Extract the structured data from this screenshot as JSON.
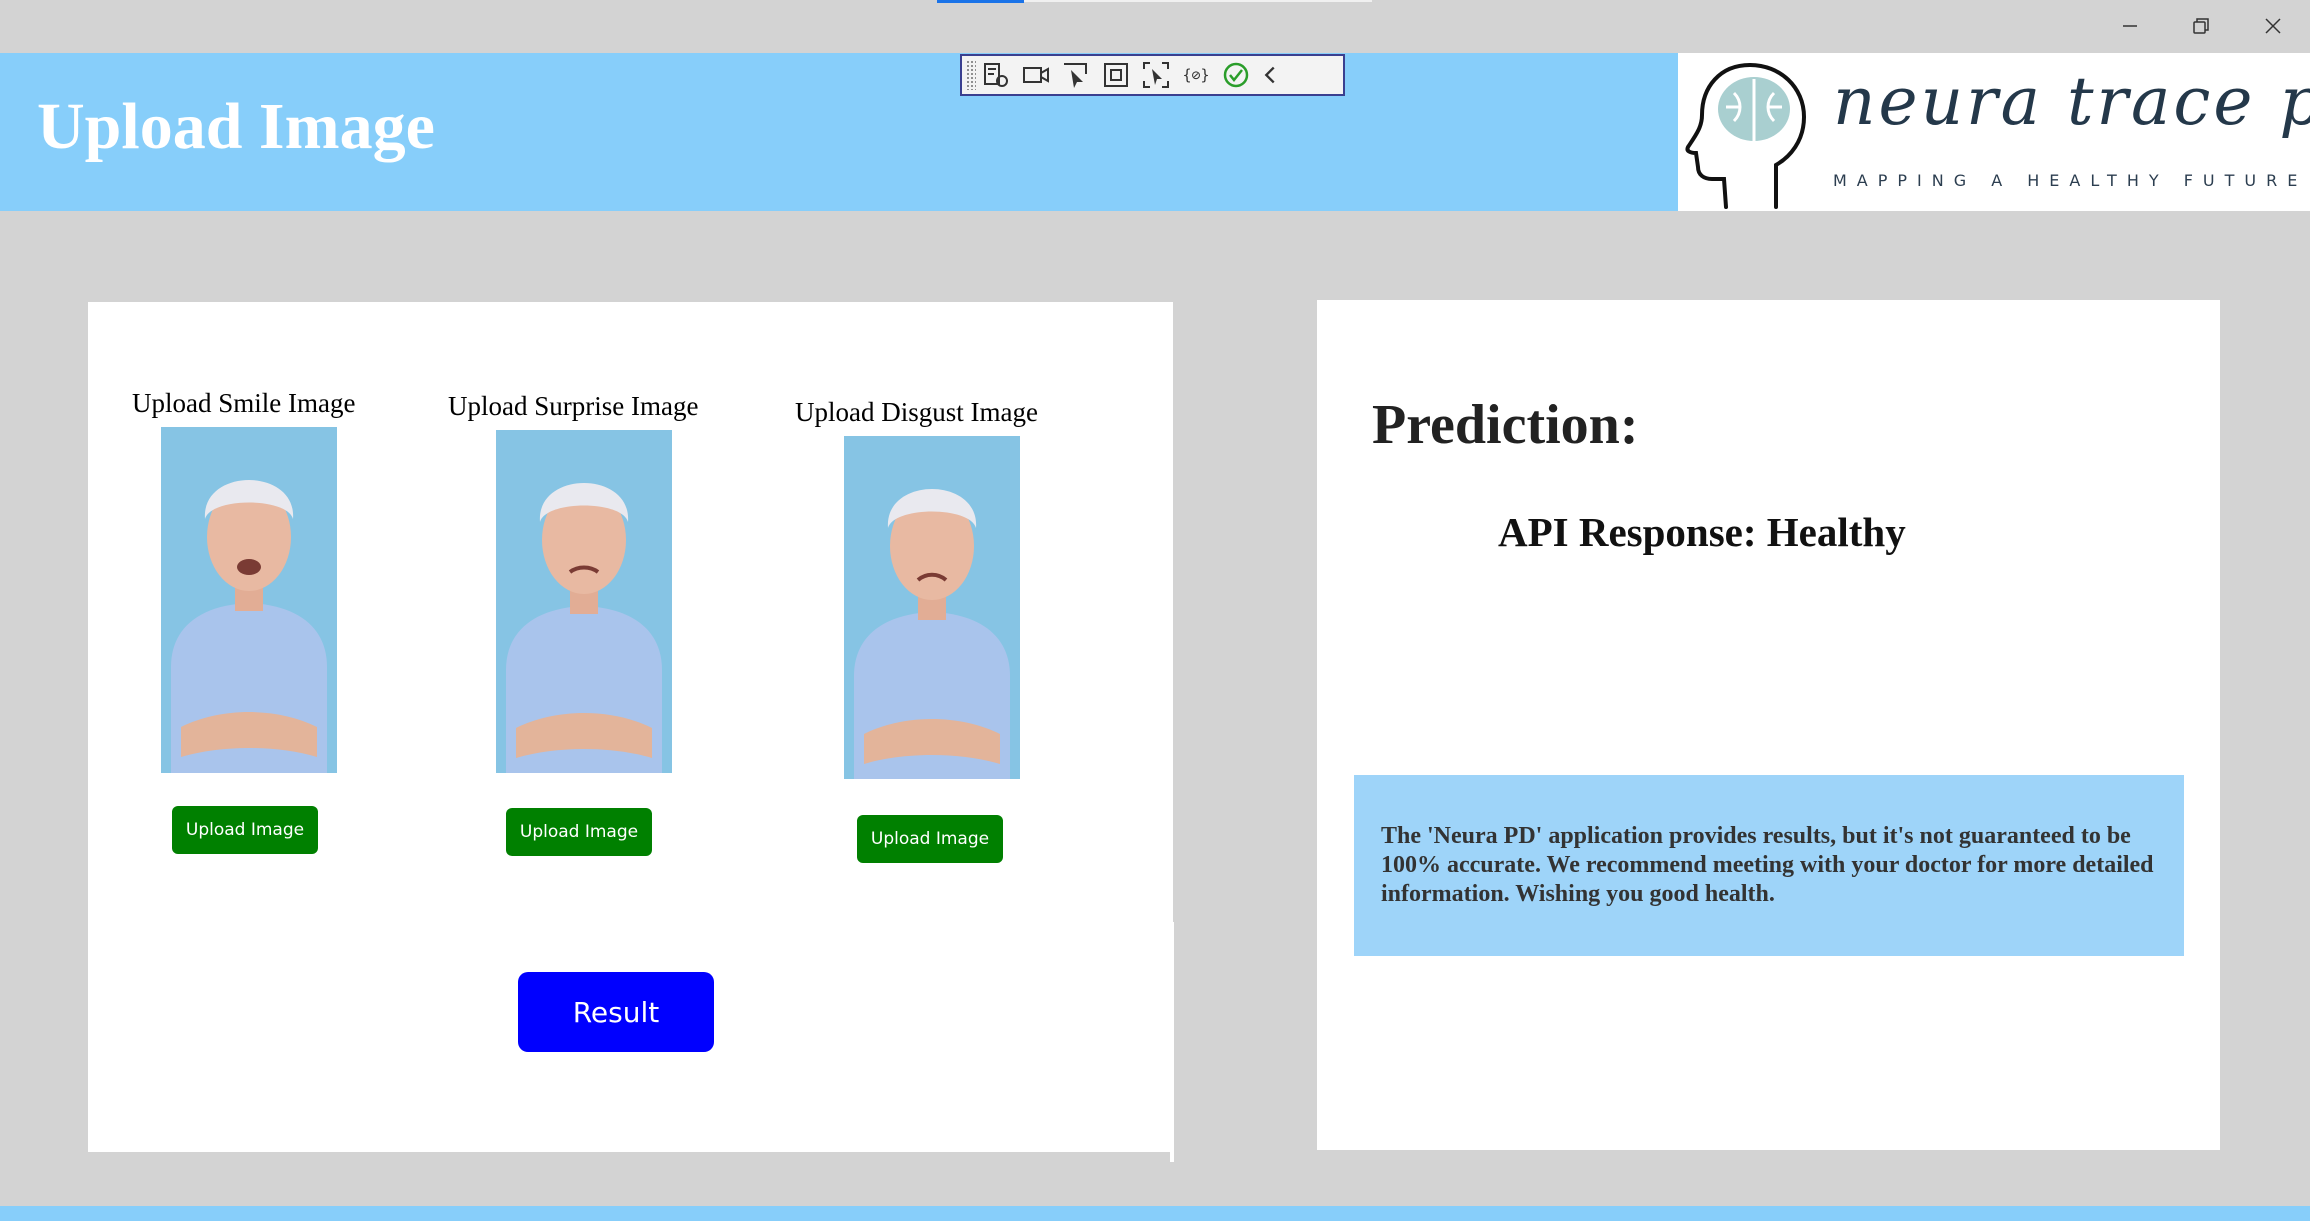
{
  "header": {
    "title": "Upload Image",
    "logo": {
      "brand": "neura trace pd",
      "tagline": "MAPPING A HEALTHY FUTURE"
    }
  },
  "window_controls": [
    "minimize-icon",
    "restore-icon",
    "close-icon"
  ],
  "debug_toolbar": {
    "icons": [
      "live-visual-tree-icon",
      "video-icon",
      "select-element-icon",
      "display-layout-adorners-icon",
      "track-focus-icon",
      "binding-failures-icon",
      "hot-reload-status-icon",
      "collapse-icon"
    ]
  },
  "uploads": [
    {
      "label": "Upload Smile Image",
      "button": "Upload Image"
    },
    {
      "label": "Upload Surprise Image",
      "button": "Upload Image"
    },
    {
      "label": "Upload Disgust Image",
      "button": "Upload Image"
    }
  ],
  "result_button": "Result",
  "prediction": {
    "heading": "Prediction:",
    "api_response": "API Response: Healthy",
    "disclaimer": "The 'Neura PD' application provides results, but it's not guaranteed to be 100% accurate. We recommend meeting with your doctor for more detailed information. Wishing you good health."
  },
  "colors": {
    "header_bg": "#87cefa",
    "upload_button": "#008000",
    "result_button": "#0000ff",
    "disclaimer_bg": "#9ed4f9",
    "page_bg": "#d3d3d3"
  }
}
